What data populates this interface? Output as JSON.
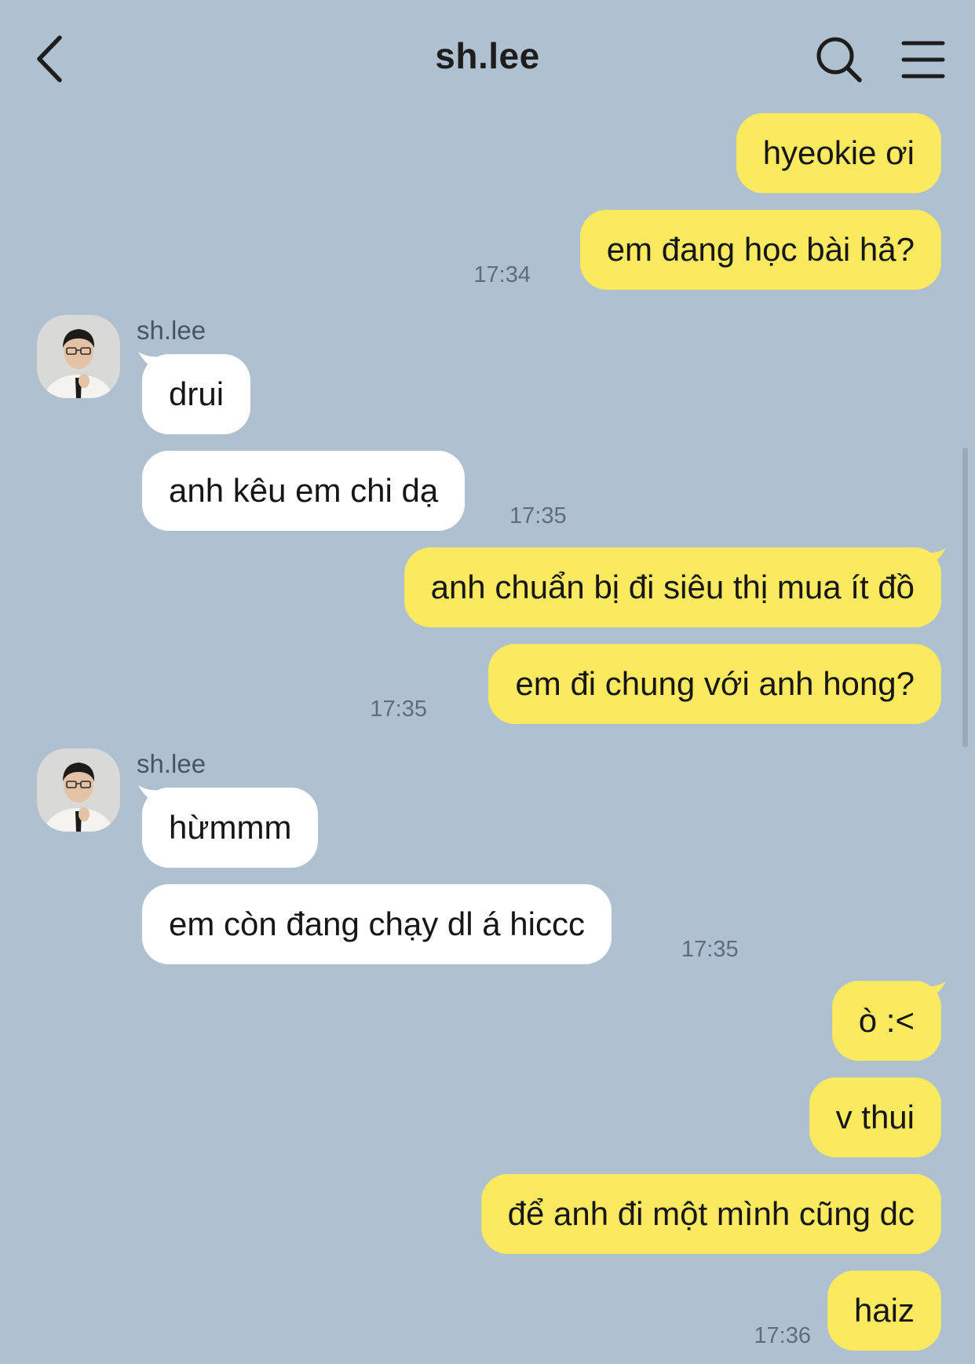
{
  "header": {
    "title": "sh.lee"
  },
  "messages": [
    {
      "text": "hyeokie ơi"
    },
    {
      "text": "em đang học bài hả?",
      "time": "17:34"
    },
    {
      "sender": "sh.lee"
    },
    {
      "text": "drui"
    },
    {
      "text": "anh kêu em chi dạ",
      "time": "17:35"
    },
    {
      "text": "anh chuẩn bị đi siêu thị mua ít đồ"
    },
    {
      "text": "em đi chung với anh hong?",
      "time": "17:35"
    },
    {
      "sender": "sh.lee"
    },
    {
      "text": "hừmmm"
    },
    {
      "text": "em còn đang chạy dl á hiccc",
      "time": "17:35"
    },
    {
      "text": "ò :<"
    },
    {
      "text": "v thui"
    },
    {
      "text": "để anh đi một mình cũng dc"
    },
    {
      "text": "haiz",
      "time": "17:36"
    }
  ],
  "colors": {
    "background": "#afc1d1",
    "outgoing_bubble": "#fbe960",
    "incoming_bubble": "#ffffff"
  }
}
